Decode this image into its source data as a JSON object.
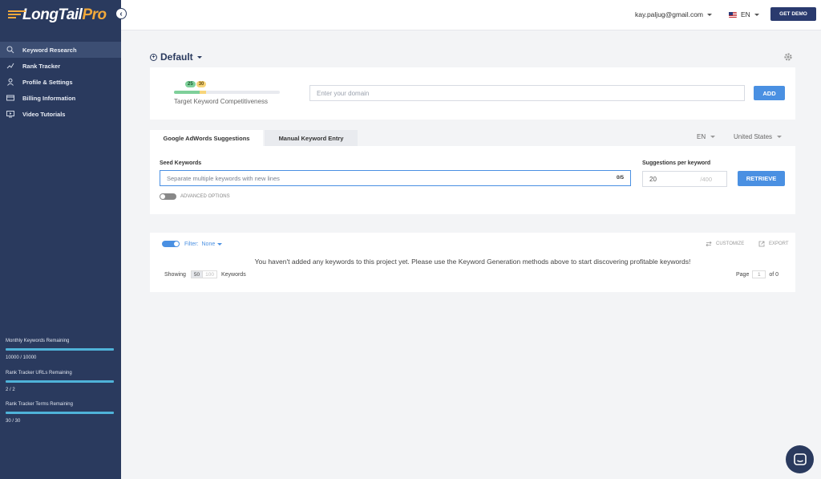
{
  "brand": {
    "name_main": "LongTail",
    "name_pro": "Pro"
  },
  "sidebar": {
    "items": [
      {
        "label": "Keyword Research",
        "icon": "search-icon",
        "active": true
      },
      {
        "label": "Rank Tracker",
        "icon": "trend-icon",
        "active": false
      },
      {
        "label": "Profile & Settings",
        "icon": "user-icon",
        "active": false
      },
      {
        "label": "Billing Information",
        "icon": "card-icon",
        "active": false
      },
      {
        "label": "Video Tutorials",
        "icon": "video-icon",
        "active": false
      }
    ],
    "usage": [
      {
        "label": "Monthly Keywords Remaining",
        "value": "10000 / 10000",
        "fraction": 1.0
      },
      {
        "label": "Rank Tracker URLs Remaining",
        "value": "2 / 2",
        "fraction": 1.0
      },
      {
        "label": "Rank Tracker Terms Remaining",
        "value": "30 / 30",
        "fraction": 1.0
      }
    ]
  },
  "topbar": {
    "email": "kay.paljug@gmail.com",
    "language": "EN",
    "demo_label": "GET DEMO"
  },
  "project": {
    "name": "Default"
  },
  "competitiveness": {
    "badge_low": "25",
    "badge_high": "30",
    "label": "Target Keyword Competitiveness",
    "domain_placeholder": "Enter your domain",
    "add_label": "ADD"
  },
  "tabs": [
    {
      "label": "Google AdWords Suggestions",
      "active": true
    },
    {
      "label": "Manual Keyword Entry",
      "active": false
    }
  ],
  "selectors": {
    "language": "EN",
    "country": "United States"
  },
  "seed": {
    "label": "Seed Keywords",
    "placeholder": "Separate multiple keywords with new lines",
    "count": "0/5",
    "advanced_label": "ADVANCED OPTIONS",
    "suggestions_label": "Suggestions per keyword",
    "suggestions_value": "20",
    "suggestions_max": "/400",
    "retrieve_label": "RETRIEVE"
  },
  "results": {
    "filter_label": "Filter:",
    "filter_value": "None",
    "customize_label": "CUSTOMIZE",
    "export_label": "EXPORT",
    "empty_message": "You haven't added any keywords to this project yet. Please use the Keyword Generation methods above to start discovering profitable keywords!",
    "showing_label": "Showing",
    "page_size_selected": "50",
    "page_size_other": "100",
    "keywords_label": "Keywords",
    "page_label": "Page",
    "page_value": "1",
    "page_total": "of 0"
  },
  "colors": {
    "sidebar": "#2a3a5e",
    "accent": "#4a90e2",
    "brand_orange": "#f2a93b"
  }
}
